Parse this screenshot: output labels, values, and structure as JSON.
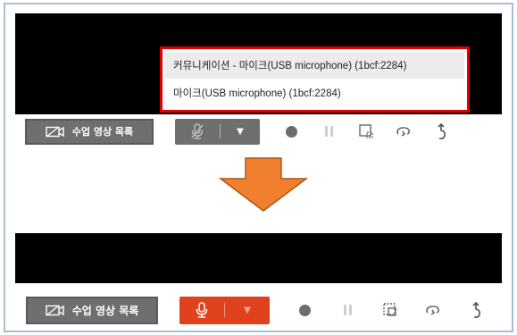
{
  "colors": {
    "video_bg": "#000000",
    "button_gray": "#6f6f6f",
    "mic_active": "#e0421e",
    "highlight_border": "#e00000",
    "arrow": "#f07f2e",
    "frame_border": "#a9bcd3"
  },
  "before": {
    "list_button_label": "수업 영상 목록",
    "mic_state": "muted",
    "dropdown": {
      "options": [
        "커뮤니케이션 - 마이크(USB microphone) (1bcf:2284)",
        "마이크(USB microphone) (1bcf:2284)"
      ],
      "highlighted_index": 0
    }
  },
  "after": {
    "list_button_label": "수업 영상 목록",
    "mic_state": "active"
  },
  "icons": {
    "list_button": "video-off-icon",
    "mic": "microphone-icon",
    "caret": "caret-down-icon",
    "record": "record-icon",
    "pause": "pause-icon",
    "region": "region-select-icon",
    "loop": "loop-icon",
    "undo": "undo-icon",
    "transition": "arrow-down-icon"
  }
}
